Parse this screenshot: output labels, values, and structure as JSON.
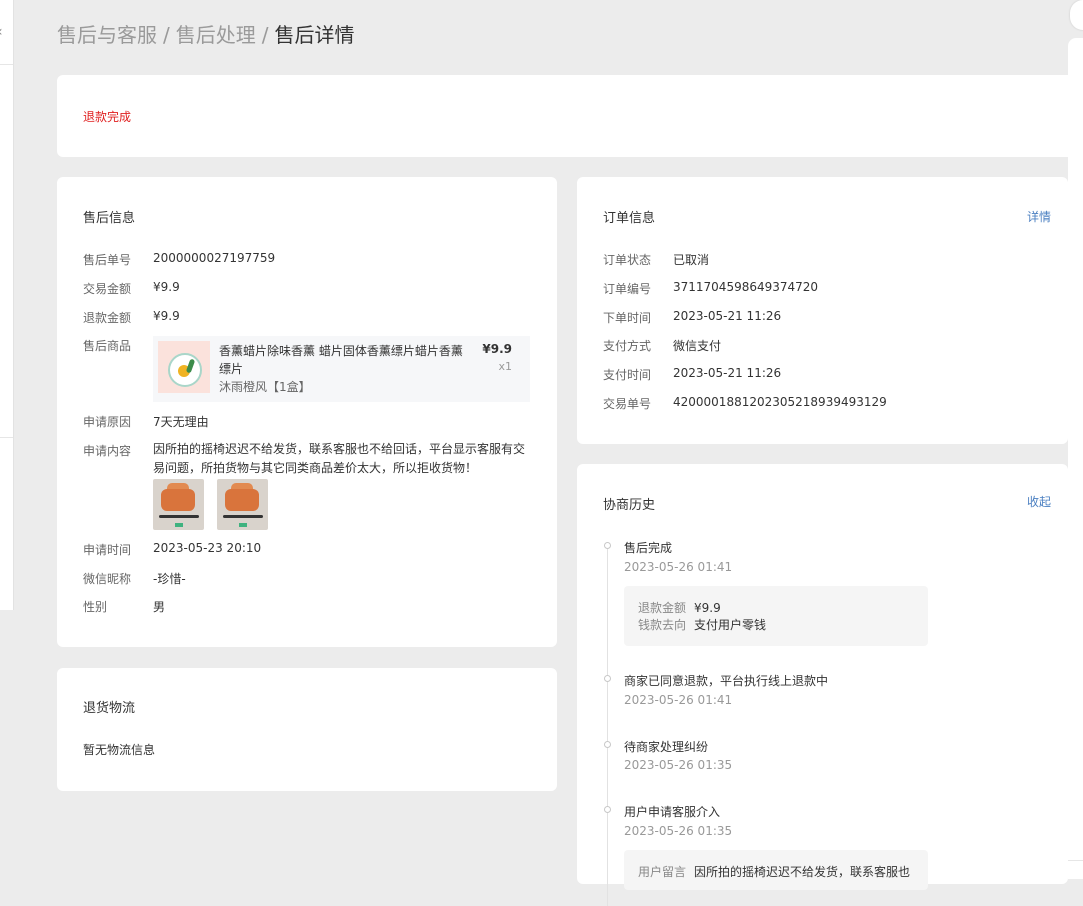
{
  "breadcrumb": {
    "level1": "售后与客服",
    "level2": "售后处理",
    "current": "售后详情",
    "separator": "/"
  },
  "status": {
    "text": "退款完成",
    "color": "#e02020"
  },
  "aftersale": {
    "title": "售后信息",
    "order_no_label": "售后单号",
    "order_no": "2000000027197759",
    "trade_amount_label": "交易金额",
    "trade_amount": "¥9.9",
    "refund_amount_label": "退款金额",
    "refund_amount": "¥9.9",
    "product_label": "售后商品",
    "product": {
      "title": "香薰蜡片除味香薰 蜡片固体香薰缥片蜡片香薰 缥片",
      "spec": "沐雨橙风【1盒】",
      "price": "¥9.9",
      "qty": "x1"
    },
    "reason_label": "申请原因",
    "reason": "7天无理由",
    "content_label": "申请内容",
    "content": "因所拍的摇椅迟迟不给发货，联系客服也不给回话，平台显示客服有交易问题，所拍货物与其它同类商品差价太大，所以拒收货物！",
    "apply_time_label": "申请时间",
    "apply_time": "2023-05-23 20:10",
    "wechat_label": "微信昵称",
    "wechat": "-珍惜-",
    "gender_label": "性别",
    "gender": "男"
  },
  "logistics": {
    "title": "退货物流",
    "empty": "暂无物流信息"
  },
  "order": {
    "title": "订单信息",
    "detail_link": "详情",
    "status_label": "订单状态",
    "status": "已取消",
    "order_no_label": "订单编号",
    "order_no": "3711704598649374720",
    "order_time_label": "下单时间",
    "order_time": "2023-05-21 11:26",
    "pay_method_label": "支付方式",
    "pay_method": "微信支付",
    "pay_time_label": "支付时间",
    "pay_time": "2023-05-21 11:26",
    "trade_no_label": "交易单号",
    "trade_no": "4200001881202305218939493129"
  },
  "history": {
    "title": "协商历史",
    "collapse_link": "收起",
    "events": [
      {
        "title": "售后完成",
        "time": "2023-05-26 01:41",
        "details": [
          {
            "key": "退款金额",
            "value": "¥9.9"
          },
          {
            "key": "钱款去向",
            "value": "支付用户零钱"
          }
        ]
      },
      {
        "title": "商家已同意退款，平台执行线上退款中",
        "time": "2023-05-26 01:41"
      },
      {
        "title": "待商家处理纠纷",
        "time": "2023-05-26 01:35"
      },
      {
        "title": "用户申请客服介入",
        "time": "2023-05-26 01:35",
        "details": [
          {
            "key": "用户留言",
            "value": "因所拍的摇椅迟迟不给发货，联系客服也"
          }
        ]
      }
    ]
  },
  "icons": {
    "sidebar_toggle": "chevron-left-icon"
  }
}
